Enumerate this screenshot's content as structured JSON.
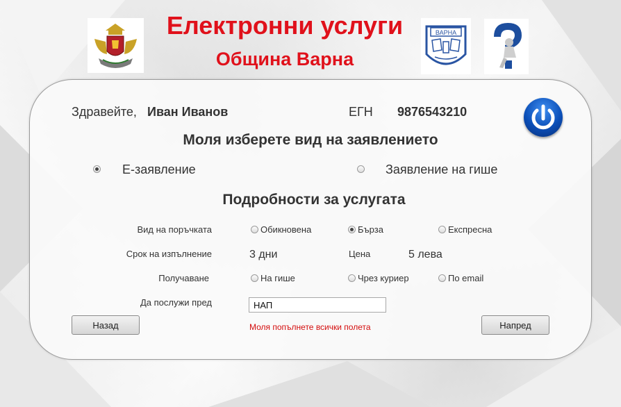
{
  "header": {
    "title": "Електронни услуги",
    "subtitle": "Община Варна"
  },
  "logos": {
    "left": "bulgarian-coat-of-arms",
    "varna": "varna-coat-of-arms",
    "varna_text": "ВАРНА",
    "help": "help-question-mark"
  },
  "user": {
    "greeting": "Здравейте,",
    "name": "Иван Иванов",
    "id_label": "ЕГН",
    "id_value": "9876543210"
  },
  "application_type": {
    "heading": "Моля изберете вид на заявлението",
    "options": [
      {
        "label": "Е-заявление",
        "checked": true
      },
      {
        "label": "Заявление на гише",
        "checked": false
      }
    ]
  },
  "details": {
    "heading": "Подробности за услугата",
    "order_type_label": "Вид на поръчката",
    "order_options": [
      {
        "label": "Обикновена",
        "checked": false
      },
      {
        "label": "Бърза",
        "checked": true
      },
      {
        "label": "Експресна",
        "checked": false
      }
    ],
    "term_label": "Срок на изпълнение",
    "term_value": "3 дни",
    "price_label": "Цена",
    "price_value": "5 лева",
    "delivery_label": "Получаване",
    "delivery_options": [
      {
        "label": "На гише",
        "checked": false
      },
      {
        "label": "Чрез куриер",
        "checked": false
      },
      {
        "label": "По email",
        "checked": false
      }
    ],
    "purpose_label": "Да послужи пред",
    "purpose_value": "НАП",
    "error": "Моля попълнете всички полета"
  },
  "buttons": {
    "back": "Назад",
    "next": "Напред"
  },
  "colors": {
    "title": "#e0111b",
    "error": "#d40d0d",
    "power": "#0b4fb8"
  }
}
